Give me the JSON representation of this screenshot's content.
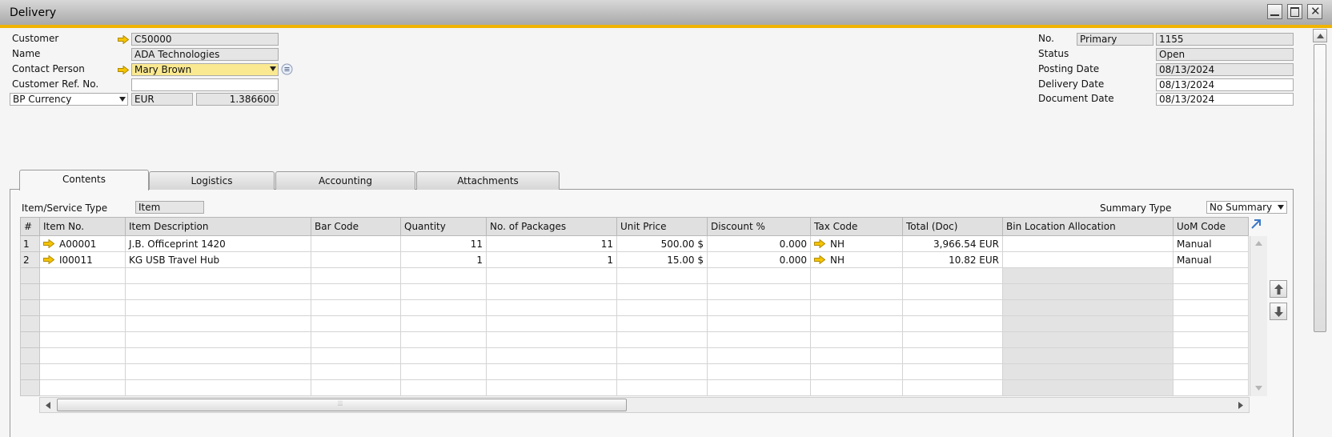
{
  "window": {
    "title": "Delivery"
  },
  "header_left": {
    "customer_label": "Customer",
    "customer_value": "C50000",
    "name_label": "Name",
    "name_value": "ADA Technologies",
    "contact_label": "Contact Person",
    "contact_value": "Mary Brown",
    "custref_label": "Customer Ref. No.",
    "custref_value": "",
    "currency_type": "BP Currency",
    "currency_code": "EUR",
    "currency_rate": "1.386600"
  },
  "header_right": {
    "no_label": "No.",
    "series": "Primary",
    "no_value": "1155",
    "status_label": "Status",
    "status_value": "Open",
    "posting_label": "Posting Date",
    "posting_value": "08/13/2024",
    "delivery_label": "Delivery Date",
    "delivery_value": "08/13/2024",
    "document_label": "Document Date",
    "document_value": "08/13/2024"
  },
  "tabs": [
    {
      "label": "Contents"
    },
    {
      "label": "Logistics"
    },
    {
      "label": "Accounting"
    },
    {
      "label": "Attachments"
    }
  ],
  "contents": {
    "item_type_label": "Item/Service Type",
    "item_type_value": "Item",
    "summary_label": "Summary Type",
    "summary_value": "No Summary"
  },
  "table": {
    "columns": [
      "#",
      "Item No.",
      "Item Description",
      "Bar Code",
      "Quantity",
      "No. of Packages",
      "Unit Price",
      "Discount %",
      "Tax Code",
      "Total (Doc)",
      "Bin Location Allocation",
      "UoM Code"
    ],
    "rows": [
      [
        "1",
        "A00001",
        "J.B. Officeprint 1420",
        "",
        "11",
        "11",
        "500.00 $",
        "0.000",
        "NH",
        "3,966.54 EUR",
        "",
        "Manual"
      ],
      [
        "2",
        "I00011",
        "KG USB Travel Hub",
        "",
        "1",
        "1",
        "15.00 $",
        "0.000",
        "NH",
        "10.82 EUR",
        "",
        "Manual"
      ]
    ],
    "empty_rows": 8
  },
  "colors": {
    "accent": "#f0b400",
    "link_arrow": "#f5c400",
    "highlight_field": "#fbe991"
  },
  "icons": [
    "link-arrow-icon",
    "dropdown-arrow-icon",
    "contact-details-icon",
    "expand-icon",
    "move-up-icon",
    "move-down-icon",
    "scroll-left-icon",
    "scroll-right-icon",
    "scroll-up-icon",
    "scroll-down-icon"
  ]
}
